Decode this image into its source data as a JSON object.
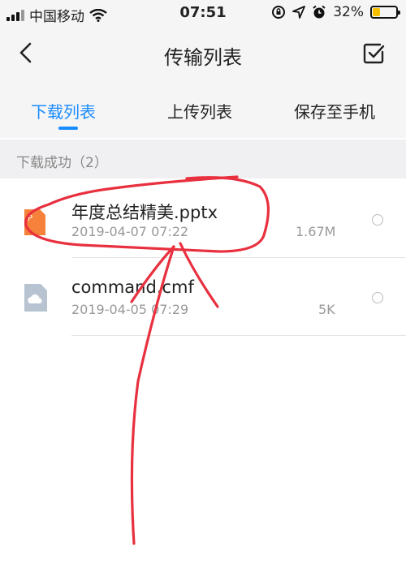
{
  "status_bar": {
    "carrier": "中国移动",
    "time": "07:51",
    "battery_percent": "32%",
    "battery_level": 0.32,
    "icons": [
      "signal-bars-icon",
      "wifi-icon",
      "rotation-lock-icon",
      "location-icon",
      "alarm-icon",
      "battery-icon"
    ]
  },
  "nav": {
    "title": "传输列表",
    "back_icon": "chevron-left-icon",
    "select_icon": "check-square-icon"
  },
  "tabs": [
    {
      "label": "下载列表",
      "active": true
    },
    {
      "label": "上传列表",
      "active": false
    },
    {
      "label": "保存至手机",
      "active": false
    }
  ],
  "section": {
    "title": "下载成功（2）"
  },
  "files": [
    {
      "name": "年度总结精美.pptx",
      "date": "2019-04-07 07:22",
      "size": "1.67M",
      "icon": "ppt-file-icon"
    },
    {
      "name": "command.cmf",
      "date": "2019-04-05 07:29",
      "size": "5K",
      "icon": "cloud-file-icon"
    }
  ],
  "colors": {
    "accent": "#1a8cff",
    "annotation": "#e8303f",
    "ppt_icon": "#f5813a"
  }
}
